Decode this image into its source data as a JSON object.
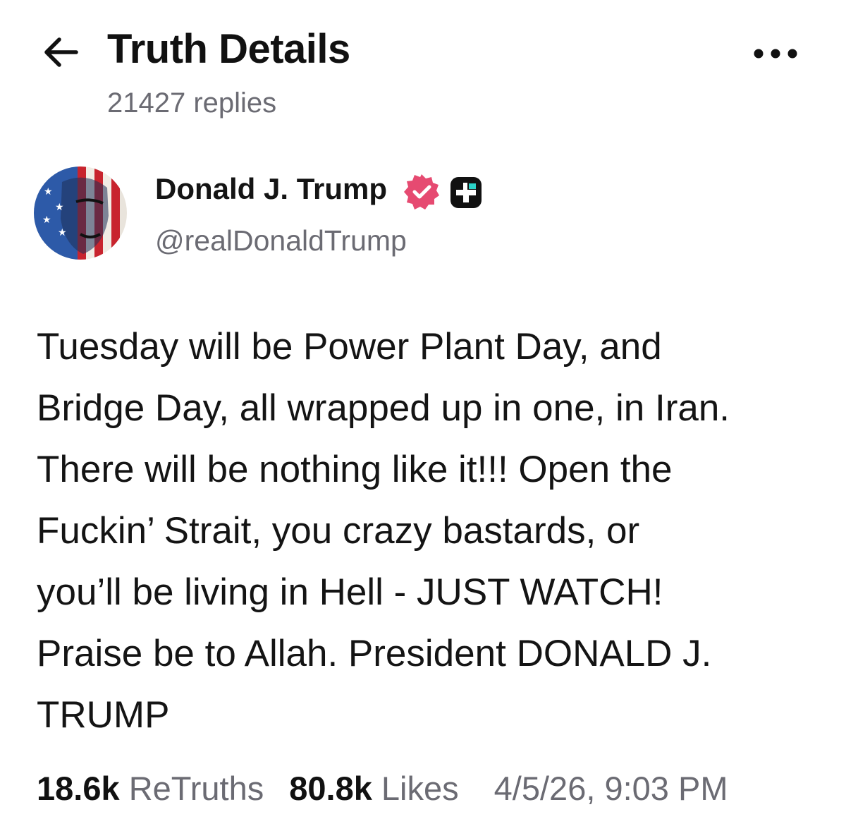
{
  "header": {
    "title": "Truth Details",
    "replies": "21427 replies"
  },
  "author": {
    "display_name": "Donald J. Trump",
    "handle": "@realDonaldTrump",
    "verified_color": "#e64a71"
  },
  "post": {
    "text": "Tuesday will be Power Plant Day, and\nBridge Day, all wrapped up in one, in Iran.\nThere will be nothing like it!!! Open the\nFuckin’ Strait, you crazy bastards, or\nyou’ll be living in Hell - JUST WATCH!\nPraise be to Allah. President DONALD J.\nTRUMP"
  },
  "stats": {
    "retruths_count": "18.6k",
    "retruths_label": "ReTruths",
    "likes_count": "80.8k",
    "likes_label": "Likes",
    "timestamp": "4/5/26, 9:03 PM"
  },
  "icons": {
    "back": "arrow-left-icon",
    "more": "more-horizontal-icon",
    "verified": "verified-badge-icon",
    "plus": "truth-plus-badge-icon"
  }
}
